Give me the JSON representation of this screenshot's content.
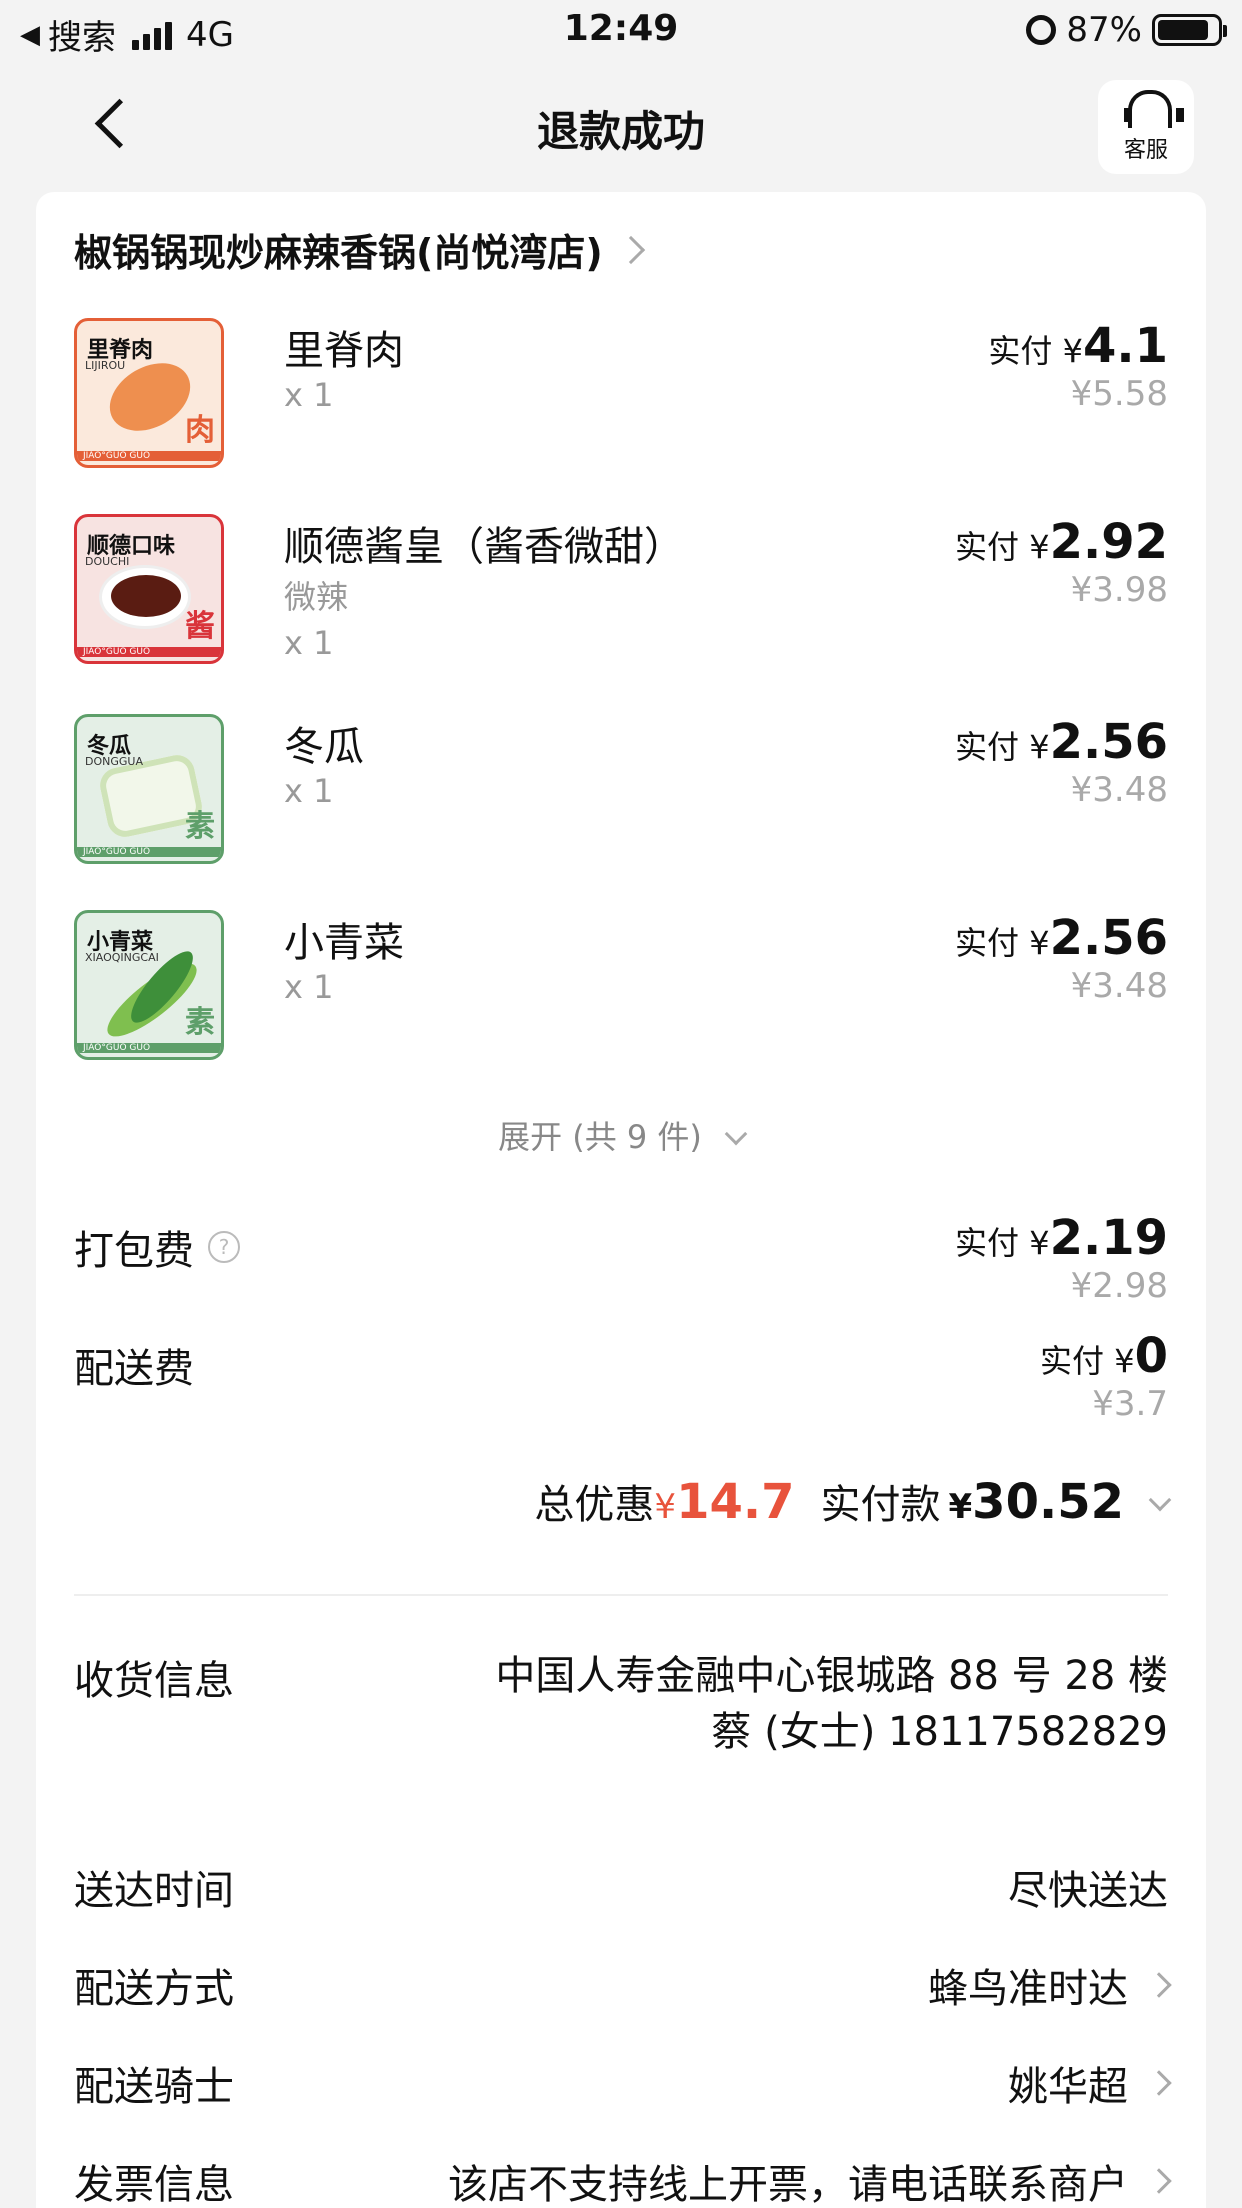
{
  "status_bar": {
    "back_app": "搜索",
    "network": "4G",
    "time": "12:49",
    "battery": "87%"
  },
  "nav": {
    "title": "退款成功",
    "service_label": "客服"
  },
  "shop": {
    "name": "椒锅锅现炒麻辣香锅(尚悦湾店)"
  },
  "items": [
    {
      "name": "里脊肉",
      "spec": "",
      "qty": "x 1",
      "paid_label": "实付 ¥",
      "paid": "4.1",
      "original": "¥5.58",
      "thumb": {
        "label": "里脊肉",
        "sub": "LIJIROU",
        "char": "肉",
        "footer": "JIAO°GUO GUO",
        "color": "#e45f37"
      }
    },
    {
      "name": "顺德酱皇（酱香微甜）",
      "spec": "微辣",
      "qty": "x 1",
      "paid_label": "实付 ¥",
      "paid": "2.92",
      "original": "¥3.98",
      "thumb": {
        "label": "顺德口味",
        "sub": "DOUCHI",
        "char": "酱",
        "footer": "JIAO°GUO GUO",
        "color": "#d9343a"
      }
    },
    {
      "name": "冬瓜",
      "spec": "",
      "qty": "x 1",
      "paid_label": "实付 ¥",
      "paid": "2.56",
      "original": "¥3.48",
      "thumb": {
        "label": "冬瓜",
        "sub": "DONGGUA",
        "char": "素",
        "footer": "JIAO°GUO GUO",
        "color": "#5e9f6a"
      }
    },
    {
      "name": "小青菜",
      "spec": "",
      "qty": "x 1",
      "paid_label": "实付 ¥",
      "paid": "2.56",
      "original": "¥3.48",
      "thumb": {
        "label": "小青菜",
        "sub": "XIAOQINGCAI",
        "char": "素",
        "footer": "JIAO°GUO GUO",
        "color": "#5e9f6a"
      }
    }
  ],
  "expand": {
    "label": "展开 (共 9 件)"
  },
  "fees": {
    "packing": {
      "label": "打包费",
      "help": "?",
      "paid_label": "实付 ¥",
      "paid": "2.19",
      "original": "¥2.98"
    },
    "delivery": {
      "label": "配送费",
      "paid_label": "实付 ¥",
      "paid": "0",
      "original": "¥3.7"
    }
  },
  "totals": {
    "discount_label": "总优惠",
    "discount_currency": "¥",
    "discount": "14.7",
    "paid_label": "实付款",
    "paid_currency": "¥",
    "paid": "30.52"
  },
  "info": {
    "address_label": "收货信息",
    "address_line1": "中国人寿金融中心银城路 88 号 28 楼",
    "address_line2": "蔡 (女士) 18117582829",
    "time_label": "送达时间",
    "time_value": "尽快送达",
    "method_label": "配送方式",
    "method_value": "蜂鸟准时达",
    "rider_label": "配送骑士",
    "rider_value": "姚华超",
    "invoice_label": "发票信息",
    "invoice_value": "该店不支持线上开票，请电话联系商户"
  }
}
